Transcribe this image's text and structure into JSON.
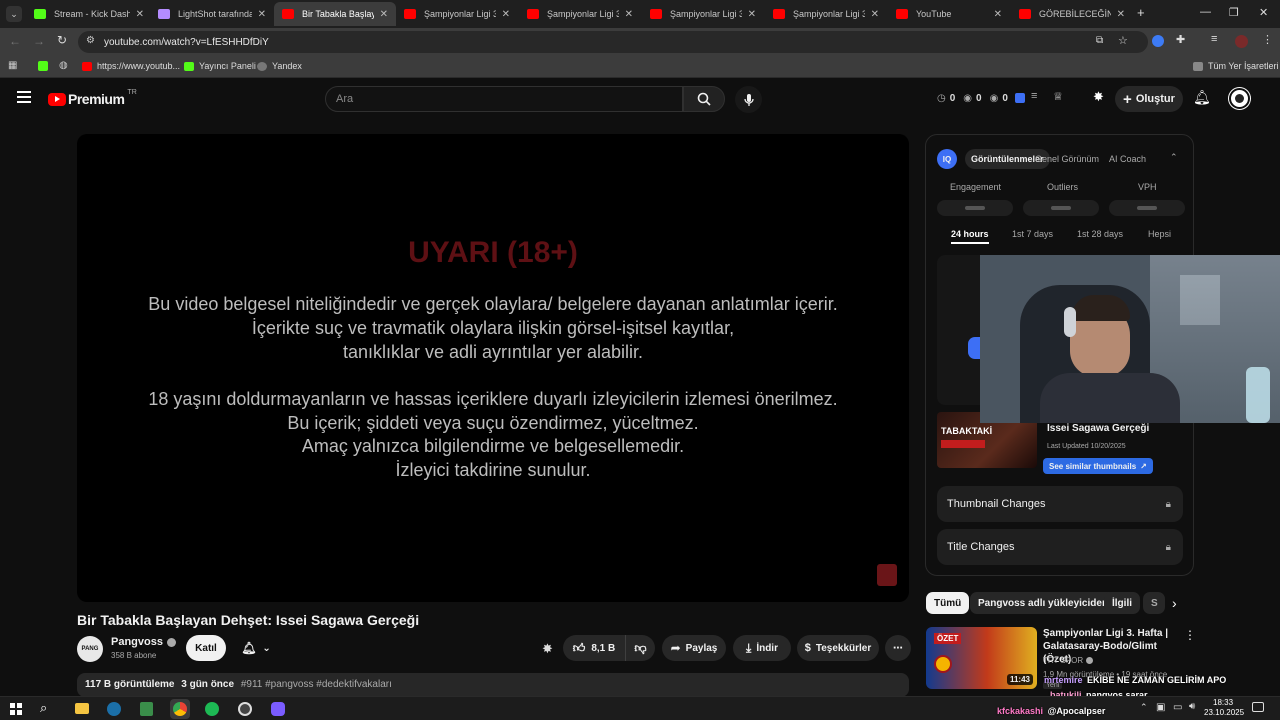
{
  "browser": {
    "tabs": [
      {
        "title": "Stream - Kick Dashboard",
        "color": "#53fc18"
      },
      {
        "title": "LightShot tarafından",
        "color": "#b48cff"
      },
      {
        "title": "Bir Tabakla Başlayan",
        "color": "#ff0000"
      },
      {
        "title": "Şampiyonlar Ligi 3. H",
        "color": "#ff0000"
      },
      {
        "title": "Şampiyonlar Ligi 3. H",
        "color": "#ff0000"
      },
      {
        "title": "Şampiyonlar Ligi 3. H",
        "color": "#ff0000"
      },
      {
        "title": "Şampiyonlar Ligi 3. H",
        "color": "#ff0000"
      },
      {
        "title": "YouTube",
        "color": "#ff0000"
      },
      {
        "title": "GÖREBİLECEĞİNİZ EN",
        "color": "#ff0000"
      }
    ],
    "url": "youtube.com/watch?v=LfESHHDfDiY",
    "bookmarks": [
      "https://www.youtub...",
      "Yayıncı Paneli",
      "Yandex"
    ],
    "all_bookmarks": "Tüm Yer İşaretleri"
  },
  "masthead": {
    "logo": "Premium",
    "region": "TR",
    "search_placeholder": "Ara",
    "counters": [
      "0",
      "0",
      "0"
    ],
    "create_label": "Oluştur"
  },
  "player": {
    "warning_title": "UYARI (18+)",
    "lines": [
      "Bu video belgesel niteliğindedir ve gerçek olaylara/ belgelere dayanan anlatımlar içerir.",
      "İçerikte suç ve travmatik olaylara ilişkin görsel-işitsel kayıtlar,",
      "tanıklıklar ve adli ayrıntılar yer alabilir.",
      "18 yaşını doldurmayanların ve hassas içeriklere duyarlı izleyicilerin izlemesi önerilmez.",
      "Bu içerik; şiddeti veya suçu özendirmez, yüceltmez.",
      "Amaç yalnızca bilgilendirme ve belgesellemedir.",
      "İzleyici takdirine sunulur."
    ]
  },
  "video": {
    "title": "Bir Tabakla Başlayan Dehşet: Issei Sagawa Gerçeği",
    "channel": "Pangvoss",
    "subscribers": "358 B abone",
    "join_label": "Katıl",
    "likes": "8,1 B",
    "share_label": "Paylaş",
    "download_label": "İndir",
    "thanks_label": "Teşekkürler",
    "views": "117 B görüntüleme",
    "age": "3 gün önce",
    "tags": "#911 #pangvoss #dedektifvakaları"
  },
  "vidiq": {
    "badge": "IQ",
    "tabs": [
      "Görüntülenmeler",
      "Genel Görünüm",
      "AI Coach"
    ],
    "metrics": [
      "Engagement",
      "Outliers",
      "VPH"
    ],
    "ranges": [
      "24 hours",
      "1st 7 days",
      "1st 28 days",
      "Hepsi"
    ],
    "thumb_title": "Issei Sagawa Gerçeği",
    "last_updated": "Last Updated 10/20/2025",
    "similar_btn": "See similar thumbnails",
    "thumb_text": "TABAKTAKİ",
    "thumbnail_changes": "Thumbnail Changes",
    "title_changes": "Title Changes"
  },
  "chips": [
    "Tümü",
    "Pangvoss adlı yükleyiciden",
    "İlgili",
    "S"
  ],
  "recommended": {
    "title": "Şampiyonlar Ligi 3. Hafta | Galatasaray-Bodo/Glimt (Özet)",
    "channel": "TRT SPOR",
    "meta": "1,9 Mn görüntüleme • 19 saat önce",
    "badge": "Yeni",
    "duration": "11:43",
    "thumb_label": "ÖZET"
  },
  "chat": [
    {
      "user": "mrtemire",
      "text": "EKİBE NE ZAMAN GELİRİM APO"
    },
    {
      "user": "batukili",
      "text": "pangvos sarar"
    },
    {
      "user": "kfckakashi",
      "text": "@Apocalpser"
    }
  ],
  "taskbar": {
    "time": "18:33",
    "date": "23.10.2025"
  }
}
